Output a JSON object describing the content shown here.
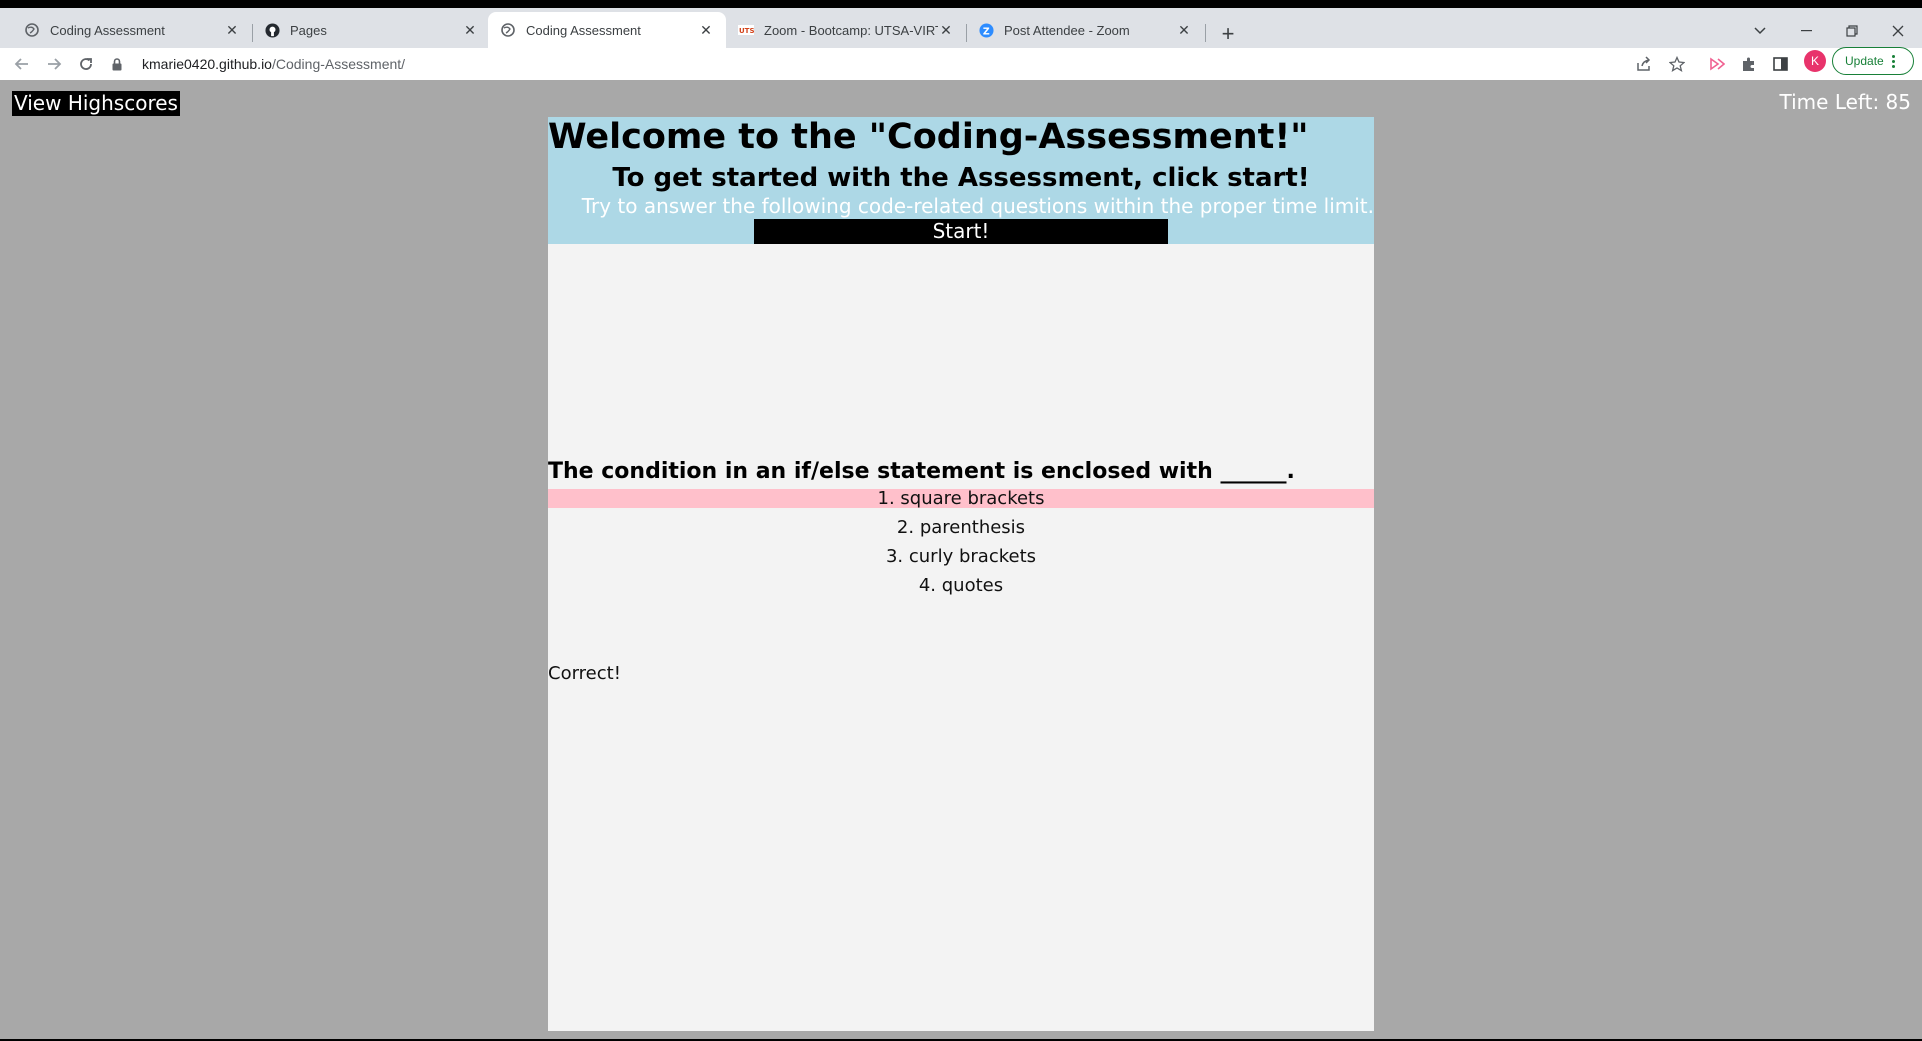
{
  "browser": {
    "tabs": [
      {
        "title": "Coding Assessment",
        "favicon": "globe-icon",
        "active": false
      },
      {
        "title": "Pages",
        "favicon": "github-icon",
        "active": false
      },
      {
        "title": "Coding Assessment",
        "favicon": "globe-icon",
        "active": true
      },
      {
        "title": "Zoom - Bootcamp: UTSA-VIRT-FS",
        "favicon": "utsa-icon",
        "active": false
      },
      {
        "title": "Post Attendee - Zoom",
        "favicon": "zoom-icon",
        "active": false
      }
    ],
    "address": {
      "host": "kmarie0420.github.io",
      "path": "/Coding-Assessment/"
    },
    "profile_initial": "K",
    "update_label": "Update"
  },
  "page": {
    "highscores_label": "View Highscores",
    "timer_label": "Time Left: 85",
    "title": "Welcome to the \"Coding-Assessment!\"",
    "subtitle": "To get started with the Assessment, click start!",
    "instructions": "Try to answer the following code-related questions within the proper time limit.",
    "start_label": "Start!",
    "question": "The condition in an if/else statement is enclosed with ______.",
    "answers": [
      "1. square brackets",
      "2. parenthesis",
      "3. curly brackets",
      "4. quotes"
    ],
    "feedback": "Correct!"
  },
  "colors": {
    "page_bg": "#a8a8a8",
    "container_bg": "#f3f3f3",
    "header_bg": "#add8e6",
    "highlight_answer": "#ffc0cb",
    "button_bg": "#000000",
    "update_green": "#188038",
    "avatar": "#e8336b"
  }
}
